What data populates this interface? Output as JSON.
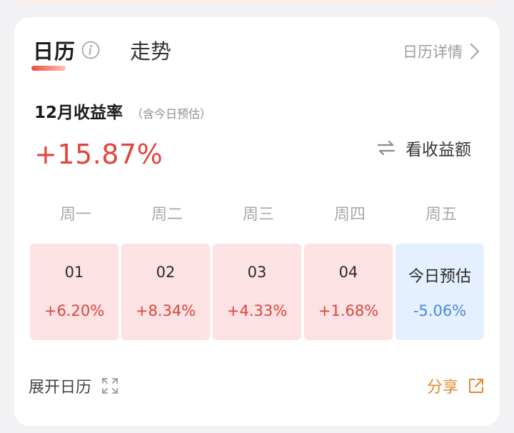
{
  "header": {
    "tabs": [
      {
        "label": "日历",
        "active": true
      },
      {
        "label": "走势",
        "active": false
      }
    ],
    "detail_link": "日历详情"
  },
  "summary": {
    "title": "12月收益率",
    "note": "（含今日预估）",
    "value": "+15.87%",
    "toggle_label": "看收益额"
  },
  "weekdays": [
    "周一",
    "周二",
    "周三",
    "周四",
    "周五"
  ],
  "days": [
    {
      "label": "01",
      "value": "+6.20%"
    },
    {
      "label": "02",
      "value": "+8.34%"
    },
    {
      "label": "03",
      "value": "+4.33%"
    },
    {
      "label": "04",
      "value": "+1.68%"
    },
    {
      "label": "今日预估",
      "value": "-5.06%"
    }
  ],
  "footer": {
    "expand_label": "展开日历",
    "share_label": "分享"
  },
  "colors": {
    "gain": "#e0463c",
    "loss": "#4a89da",
    "gain_bg": "#fce2e2",
    "estimate_bg": "#e4efff",
    "accent_orange": "#e2892d"
  },
  "icons": [
    "info-icon",
    "chevron-right-icon",
    "swap-icon",
    "expand-icon",
    "share-icon"
  ]
}
